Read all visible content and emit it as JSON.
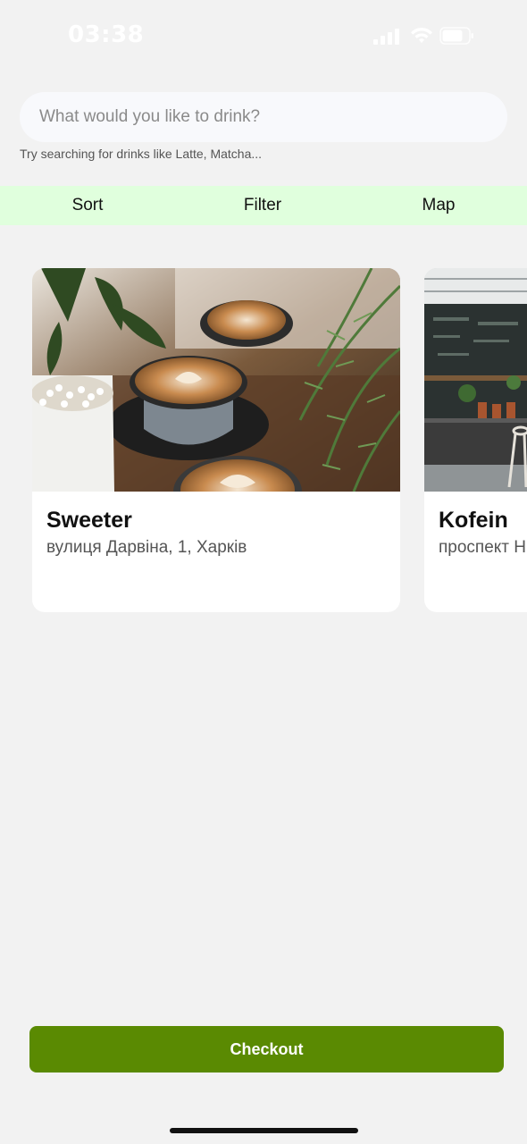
{
  "status_bar": {
    "time": "03:38",
    "icons": [
      "signal-icon",
      "wifi-icon",
      "battery-icon"
    ]
  },
  "search": {
    "placeholder": "What would you like to drink?",
    "hint": "Try searching for drinks like Latte, Matcha..."
  },
  "actions": {
    "sort": "Sort",
    "filter": "Filter",
    "map": "Map"
  },
  "cafes": [
    {
      "name": "Sweeter",
      "address": "вулиця Дарвіна, 1, Харків"
    },
    {
      "name": "Kofein",
      "address": "проспект Н"
    }
  ],
  "checkout": {
    "label": "Checkout"
  },
  "colors": {
    "background": "#f2f2f2",
    "action_bar": "#e0ffdd",
    "checkout": "#5a8a02"
  }
}
